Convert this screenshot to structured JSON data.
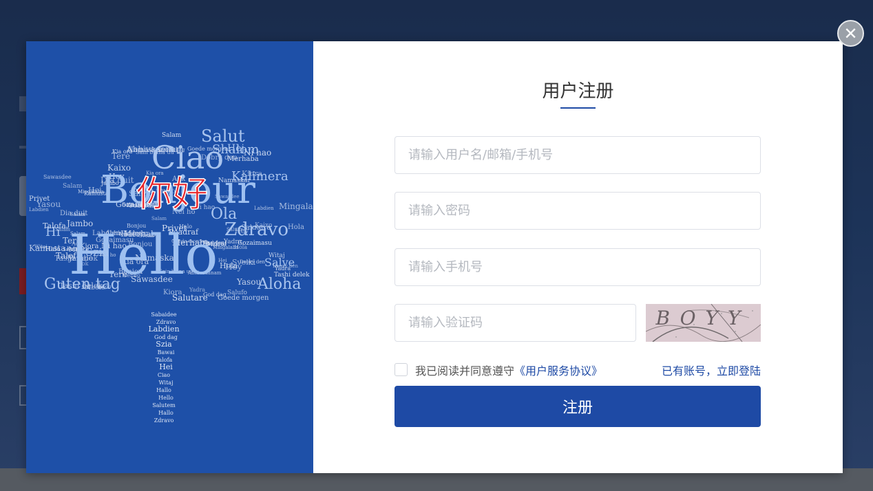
{
  "colors": {
    "primary": "#1e4aa5",
    "left_panel_bg": "#1e50a8",
    "highlight_red": "#e8252a"
  },
  "close": {
    "icon": "close-icon",
    "glyph": "✕"
  },
  "illustration": {
    "icon": "hello-word-cloud-tree",
    "highlight": "你好",
    "big_words": [
      "Hello",
      "Bonjour",
      "Ciao",
      "Salut",
      "Zdravo",
      "Ola",
      "Shalom",
      "Guten tag",
      "Aloha",
      "Hi",
      "Hej",
      "Szia",
      "Salve",
      "Kalimera"
    ],
    "small_words": [
      "Salam",
      "Kaixo",
      "Kamusta",
      "Talofa",
      "Privet",
      "Merhaba",
      "Hey",
      "Jambo",
      "Gozaimasu",
      "Salufo",
      "Yadra",
      "Labdien",
      "God dag",
      "Hei",
      "Tere",
      "Mbote",
      "Aok",
      "Witaj",
      "Ni hao",
      "Sveiki",
      "Nei ho",
      "Kia ora",
      "Salutare",
      "Tashi delek",
      "Mingalaba",
      "Sawasdee",
      "Namaskar",
      "Goede morgen",
      "Yasou",
      "Bonjou",
      "Hola",
      "Dia duit",
      "Poadraf",
      "Salam",
      "Halo",
      "Sain baina uu",
      "Dobrý den",
      "Abhivadanam",
      "Kiora"
    ],
    "trunk_words": [
      "Sabaidee",
      "Zdravo",
      "Labdien",
      "God dag",
      "Szia",
      "Bawai",
      "Talofa",
      "Hei",
      "Ciao",
      "Witaj",
      "Hallo",
      "Hello",
      "Salutem",
      "Hallo",
      "Zdravo"
    ]
  },
  "form": {
    "title": "用户注册",
    "username_placeholder": "请输入用户名/邮箱/手机号",
    "password_placeholder": "请输入密码",
    "phone_placeholder": "请输入手机号",
    "captcha_placeholder": "请输入验证码",
    "captcha_text": "BOYY",
    "agree_prefix": "我已阅读并同意遵守",
    "agree_link": "《用户服务协议》",
    "login_link": "已有账号，立即登陆",
    "submit_label": "注册"
  }
}
